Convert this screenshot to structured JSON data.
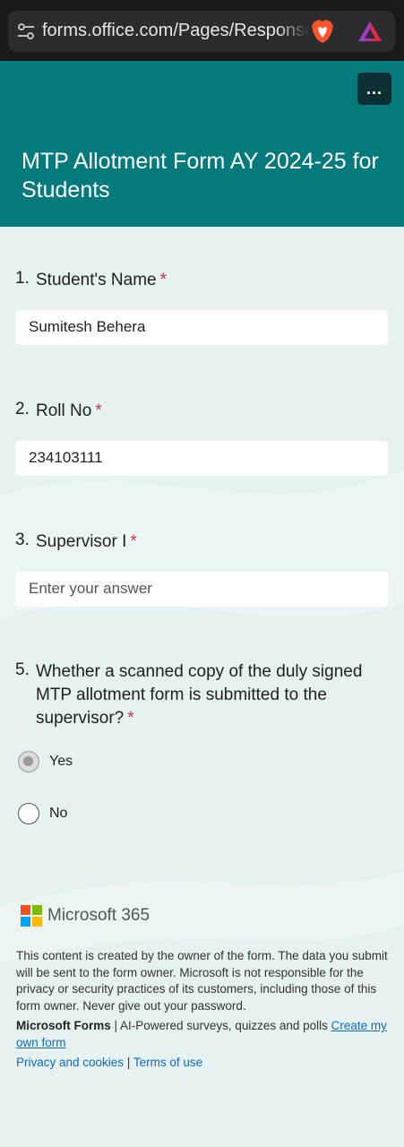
{
  "browser": {
    "url": "forms.office.com/Pages/ResponsePage.aspx"
  },
  "form": {
    "title": "MTP Allotment Form AY 2024-25 for Students",
    "more_label": "...",
    "required_mark": "*"
  },
  "questions": [
    {
      "number": "1.",
      "label": "Student's Name",
      "value": "Sumitesh Behera"
    },
    {
      "number": "2.",
      "label": "Roll No",
      "value": "234103111"
    },
    {
      "number": "3.",
      "label": "Supervisor I",
      "placeholder": "Enter your answer"
    },
    {
      "number": "5.",
      "label": "Whether a scanned copy of the duly signed MTP allotment form is submitted to the supervisor?",
      "options": [
        {
          "label": "Yes",
          "selected": true
        },
        {
          "label": "No",
          "selected": false
        }
      ]
    }
  ],
  "footer": {
    "brand": "Microsoft 365",
    "disclaimer": "This content is created by the owner of the form. The data you submit will be sent to the form owner. Microsoft is not responsible for the privacy or security practices of its customers, including those of this form owner. Never give out your password.",
    "product_name": "Microsoft Forms",
    "tagline": " | AI-Powered surveys, quizzes and polls ",
    "create_link": "Create my own form",
    "privacy_link": "Privacy and cookies",
    "separator": " | ",
    "terms_link": "Terms of use"
  },
  "colors": {
    "header_teal": "#047a7c",
    "required_red": "#c4314b",
    "link_blue": "#0f6cbd"
  }
}
